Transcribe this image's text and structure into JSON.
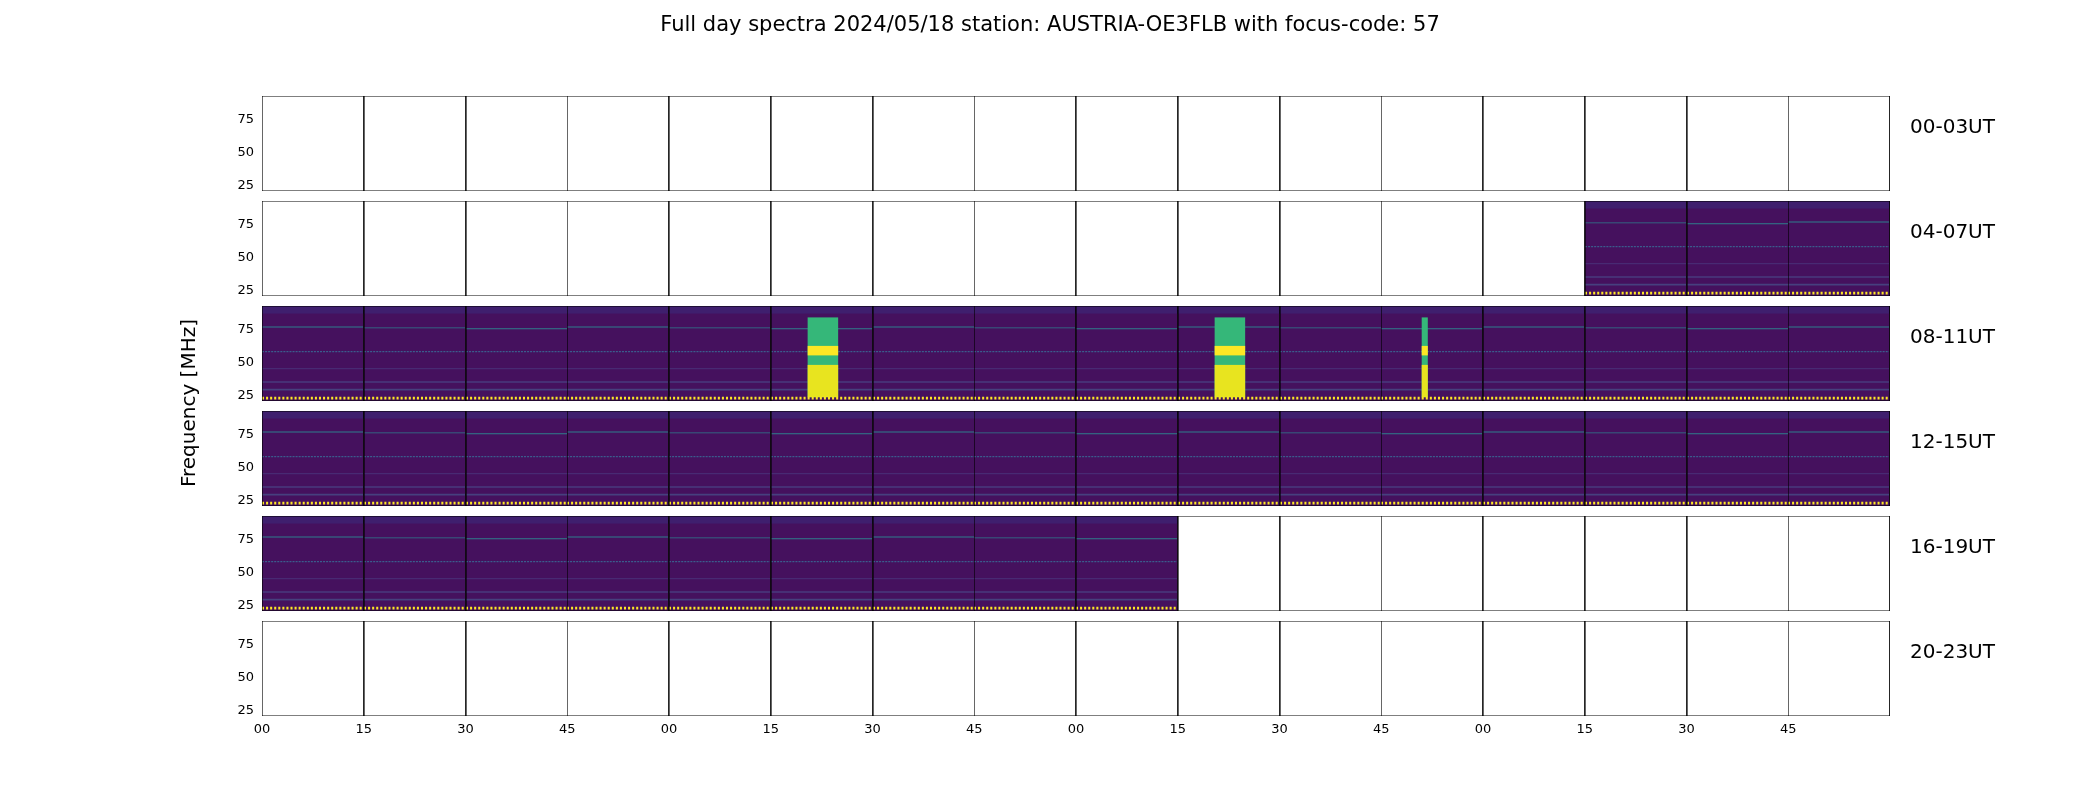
{
  "title": "Full day spectra 2024/05/18 station: AUSTRIA-OE3FLB with focus-code: 57",
  "ylabel": "Frequency [MHz]",
  "x_ticks": [
    "00",
    "15",
    "30",
    "45",
    "00",
    "15",
    "30",
    "45",
    "00",
    "15",
    "30",
    "45",
    "00",
    "15",
    "30",
    "45"
  ],
  "rows": [
    {
      "label": "00-03UT",
      "y_ticks": [
        "75",
        "50",
        "25"
      ],
      "panels": [
        {
          "kind": "empty"
        },
        {
          "kind": "empty"
        },
        {
          "kind": "empty"
        },
        {
          "kind": "empty"
        },
        {
          "kind": "empty"
        },
        {
          "kind": "empty"
        },
        {
          "kind": "empty"
        },
        {
          "kind": "empty"
        },
        {
          "kind": "empty"
        },
        {
          "kind": "empty"
        },
        {
          "kind": "empty"
        },
        {
          "kind": "empty"
        },
        {
          "kind": "empty"
        },
        {
          "kind": "empty"
        },
        {
          "kind": "empty"
        },
        {
          "kind": "empty"
        }
      ]
    },
    {
      "label": "04-07UT",
      "y_ticks": [
        "75",
        "50",
        "25"
      ],
      "panels": [
        {
          "kind": "empty"
        },
        {
          "kind": "empty"
        },
        {
          "kind": "empty"
        },
        {
          "kind": "empty"
        },
        {
          "kind": "empty"
        },
        {
          "kind": "empty"
        },
        {
          "kind": "empty"
        },
        {
          "kind": "empty"
        },
        {
          "kind": "empty"
        },
        {
          "kind": "empty"
        },
        {
          "kind": "empty"
        },
        {
          "kind": "empty"
        },
        {
          "kind": "empty"
        },
        {
          "kind": "spectrum"
        },
        {
          "kind": "spectrum"
        },
        {
          "kind": "spectrum"
        }
      ]
    },
    {
      "label": "08-11UT",
      "y_ticks": [
        "75",
        "50",
        "25"
      ],
      "panels": [
        {
          "kind": "spectrum"
        },
        {
          "kind": "spectrum"
        },
        {
          "kind": "spectrum"
        },
        {
          "kind": "spectrum"
        },
        {
          "kind": "spectrum"
        },
        {
          "kind": "burst"
        },
        {
          "kind": "spectrum"
        },
        {
          "kind": "spectrum"
        },
        {
          "kind": "spectrum"
        },
        {
          "kind": "burst"
        },
        {
          "kind": "spectrum"
        },
        {
          "kind": "spike"
        },
        {
          "kind": "spectrum"
        },
        {
          "kind": "spectrum"
        },
        {
          "kind": "spectrum"
        },
        {
          "kind": "spectrum"
        }
      ]
    },
    {
      "label": "12-15UT",
      "y_ticks": [
        "75",
        "50",
        "25"
      ],
      "panels": [
        {
          "kind": "spectrum"
        },
        {
          "kind": "spectrum"
        },
        {
          "kind": "spectrum"
        },
        {
          "kind": "spectrum"
        },
        {
          "kind": "spectrum"
        },
        {
          "kind": "spectrum"
        },
        {
          "kind": "spectrum"
        },
        {
          "kind": "spectrum"
        },
        {
          "kind": "spectrum"
        },
        {
          "kind": "spectrum"
        },
        {
          "kind": "spectrum"
        },
        {
          "kind": "spectrum"
        },
        {
          "kind": "spectrum"
        },
        {
          "kind": "spectrum"
        },
        {
          "kind": "spectrum"
        },
        {
          "kind": "spectrum"
        }
      ]
    },
    {
      "label": "16-19UT",
      "y_ticks": [
        "75",
        "50",
        "25"
      ],
      "panels": [
        {
          "kind": "spectrum"
        },
        {
          "kind": "spectrum"
        },
        {
          "kind": "spectrum"
        },
        {
          "kind": "spectrum"
        },
        {
          "kind": "spectrum"
        },
        {
          "kind": "spectrum"
        },
        {
          "kind": "spectrum"
        },
        {
          "kind": "spectrum"
        },
        {
          "kind": "spectrum"
        },
        {
          "kind": "empty"
        },
        {
          "kind": "empty"
        },
        {
          "kind": "empty"
        },
        {
          "kind": "empty"
        },
        {
          "kind": "empty"
        },
        {
          "kind": "empty"
        },
        {
          "kind": "empty"
        }
      ]
    },
    {
      "label": "20-23UT",
      "y_ticks": [
        "75",
        "50",
        "25"
      ],
      "panels": [
        {
          "kind": "empty"
        },
        {
          "kind": "empty"
        },
        {
          "kind": "empty"
        },
        {
          "kind": "empty"
        },
        {
          "kind": "empty"
        },
        {
          "kind": "empty"
        },
        {
          "kind": "empty"
        },
        {
          "kind": "empty"
        },
        {
          "kind": "empty"
        },
        {
          "kind": "empty"
        },
        {
          "kind": "empty"
        },
        {
          "kind": "empty"
        },
        {
          "kind": "empty"
        },
        {
          "kind": "empty"
        },
        {
          "kind": "empty"
        },
        {
          "kind": "empty"
        }
      ]
    }
  ]
}
